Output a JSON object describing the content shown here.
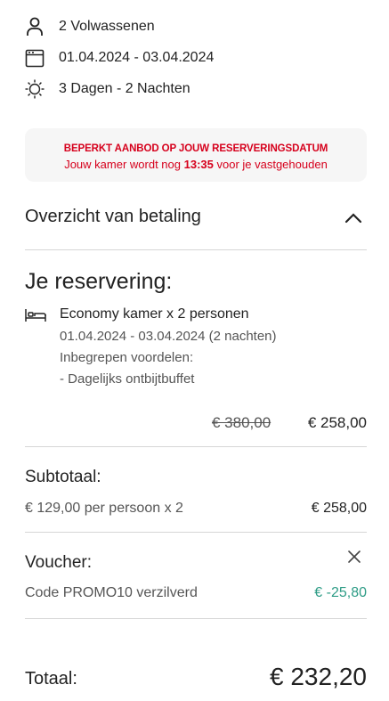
{
  "summary": {
    "guests": "2 Volwassenen",
    "dates": "01.04.2024 - 03.04.2024",
    "duration": "3 Dagen - 2 Nachten"
  },
  "alert": {
    "heading": "BEPERKT AANBOD OP JOUW RESERVERINGSDATUM",
    "message_prefix": "Jouw kamer wordt nog",
    "timer": "13:35",
    "message_suffix": "voor je vastgehouden",
    "color": "#d6001c"
  },
  "payment_overview": {
    "title": "Overzicht van betaling"
  },
  "reservation": {
    "title": "Je reservering:",
    "room": "Economy kamer x 2 personen",
    "dates": "01.04.2024 - 03.04.2024 (2 nachten)",
    "benefits_label": "Inbegrepen voordelen:",
    "benefit": "- Dagelijks ontbijtbuffet",
    "old_price": "€ 380,00",
    "new_price": "€ 258,00"
  },
  "subtotal": {
    "title": "Subtotaal:",
    "detail": "€ 129,00 per persoon x 2",
    "amount": "€ 258,00"
  },
  "voucher": {
    "title": "Voucher:",
    "detail": "Code PROMO10 verzilverd",
    "amount": "€ -25,80",
    "color": "#2e9c86"
  },
  "total": {
    "label": "Totaal:",
    "amount": "€ 232,20"
  }
}
